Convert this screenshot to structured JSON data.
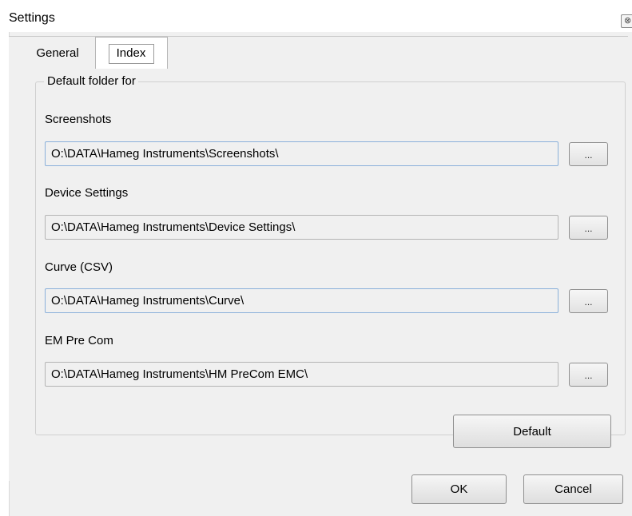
{
  "window": {
    "title": "Settings",
    "close_icon": "⊗"
  },
  "tabs": [
    {
      "label": "General",
      "active": false
    },
    {
      "label": "Index",
      "active": true
    }
  ],
  "group": {
    "legend": "Default folder for"
  },
  "fields": [
    {
      "label": "Screenshots",
      "value": "O:\\DATA\\Hameg Instruments\\Screenshots\\",
      "browse_label": "..."
    },
    {
      "label": "Device Settings",
      "value": "O:\\DATA\\Hameg Instruments\\Device Settings\\",
      "browse_label": "..."
    },
    {
      "label": "Curve (CSV)",
      "value": "O:\\DATA\\Hameg Instruments\\Curve\\",
      "browse_label": "..."
    },
    {
      "label": "EM Pre Com",
      "value": "O:\\DATA\\Hameg Instruments\\HM PreCom EMC\\",
      "browse_label": "..."
    }
  ],
  "buttons": {
    "default_label": "Default",
    "ok_label": "OK",
    "cancel_label": "Cancel"
  }
}
